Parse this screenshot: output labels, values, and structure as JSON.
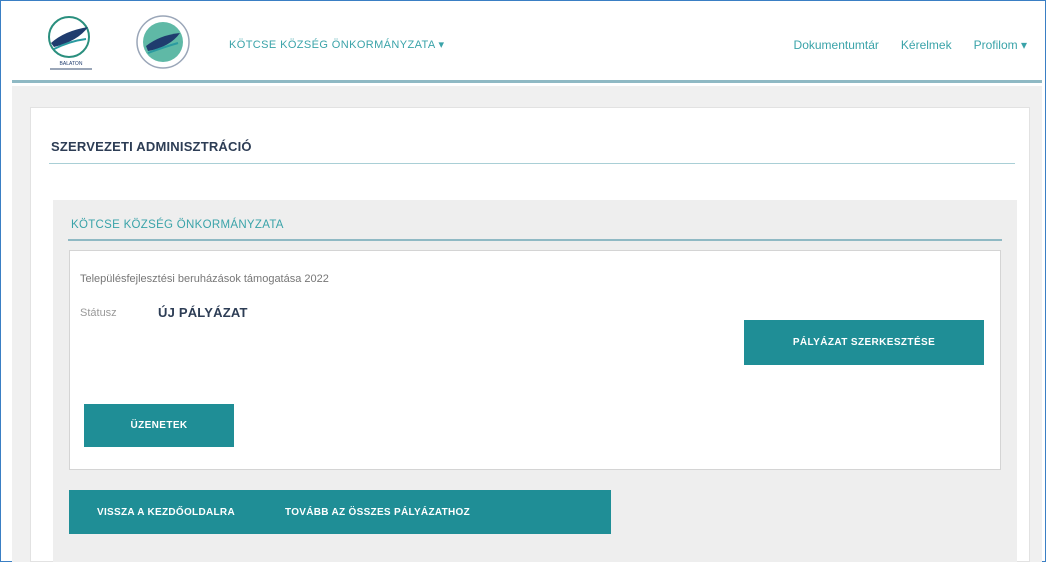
{
  "navbar": {
    "logo1_caption": "BALATON",
    "org_menu_label": "KÖTCSE KÖZSÉG ÖNKORMÁNYZATA",
    "org_menu_caret": "▾",
    "links": {
      "documents": "Dokumentumtár",
      "requests": "Kérelmek",
      "profile": "Profilom",
      "profile_caret": "▾"
    }
  },
  "main": {
    "page_title": "SZERVEZETI ADMINISZTRÁCIÓ",
    "organization": {
      "name": "KÖTCSE KÖZSÉG ÖNKORMÁNYZATA",
      "application": {
        "title": "Településfejlesztési beruházások támogatása 2022",
        "status_label": "Státusz",
        "status_value": "ÚJ PÁLYÁZAT",
        "edit_button": "PÁLYÁZAT SZERKESZTÉSE",
        "messages_button": "ÜZENETEK"
      },
      "back_button": "VISSZA A KEZDŐOLDALRA",
      "all_applications_button": "TOVÁBB AZ ÖSSZES PÁLYÁZATHOZ"
    }
  },
  "colors": {
    "accent": "#1f8e96",
    "link": "#3aa3a9",
    "title": "#2d3d55"
  }
}
